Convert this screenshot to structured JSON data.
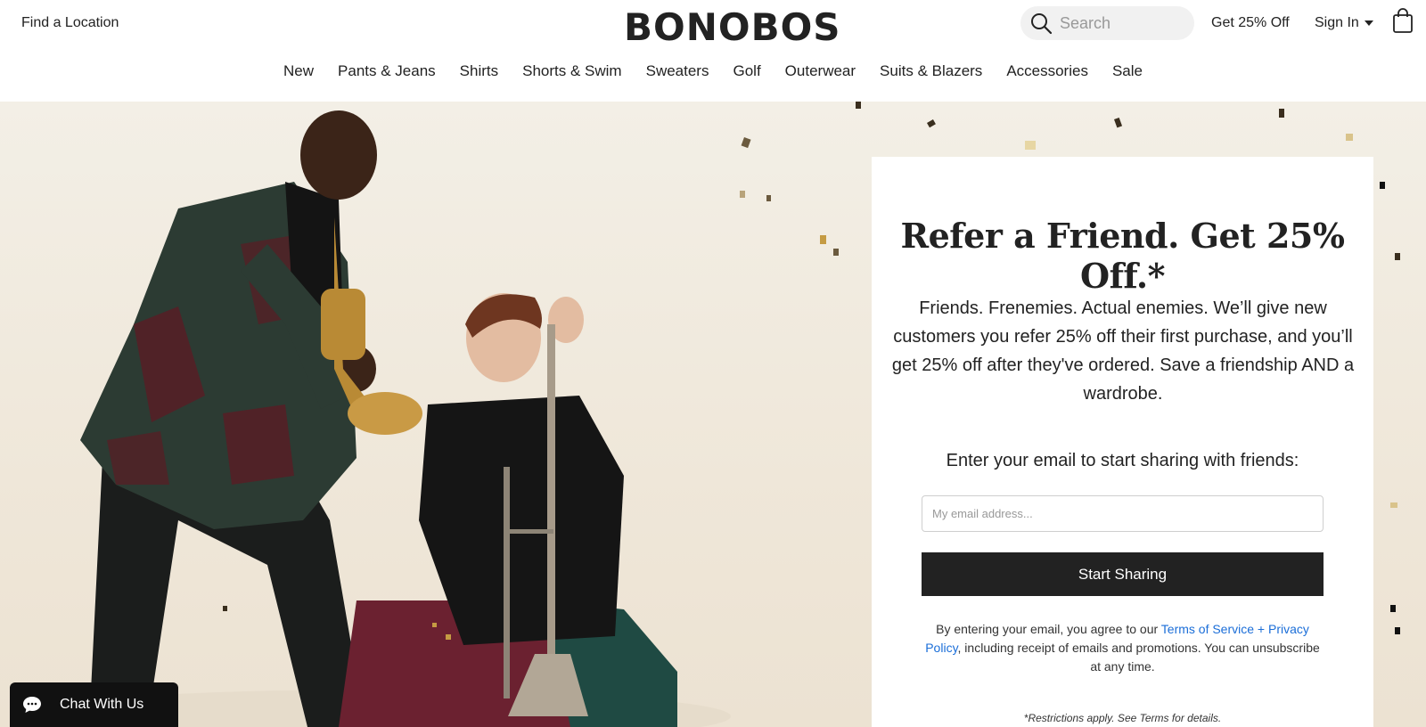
{
  "header": {
    "find_location": "Find a Location",
    "logo": "BONOBOS",
    "search_placeholder": "Search",
    "promo_link": "Get 25% Off",
    "sign_in": "Sign In"
  },
  "nav": {
    "items": [
      "New",
      "Pants & Jeans",
      "Shirts",
      "Shorts & Swim",
      "Sweaters",
      "Golf",
      "Outerwear",
      "Suits & Blazers",
      "Accessories",
      "Sale"
    ]
  },
  "card": {
    "title": "Refer a Friend. Get 25% Off.*",
    "body": "Friends. Frenemies. Actual enemies.  We’ll give new customers you refer 25% off their first purchase, and you’ll get 25% off after they've ordered. Save a friendship AND a wardrobe.",
    "prompt": "Enter your email to start sharing with friends:",
    "email_placeholder": "My email address...",
    "button_label": "Start Sharing",
    "legal_prefix": "By entering your email, you agree to our ",
    "legal_link": "Terms of Service + Privacy Policy",
    "legal_suffix": ", including receipt of emails and promotions. You can unsubscribe at any time.",
    "restrictions": "*Restrictions apply. See Terms for details."
  },
  "chat": {
    "label": "Chat With Us"
  },
  "colors": {
    "link": "#1b6ed8",
    "button": "#222222",
    "hero_bg": "#f3efe6"
  },
  "icons": {
    "search": "search-icon",
    "bag": "shopping-bag-icon",
    "chat": "chat-bubble-icon",
    "caret": "chevron-down-icon"
  }
}
